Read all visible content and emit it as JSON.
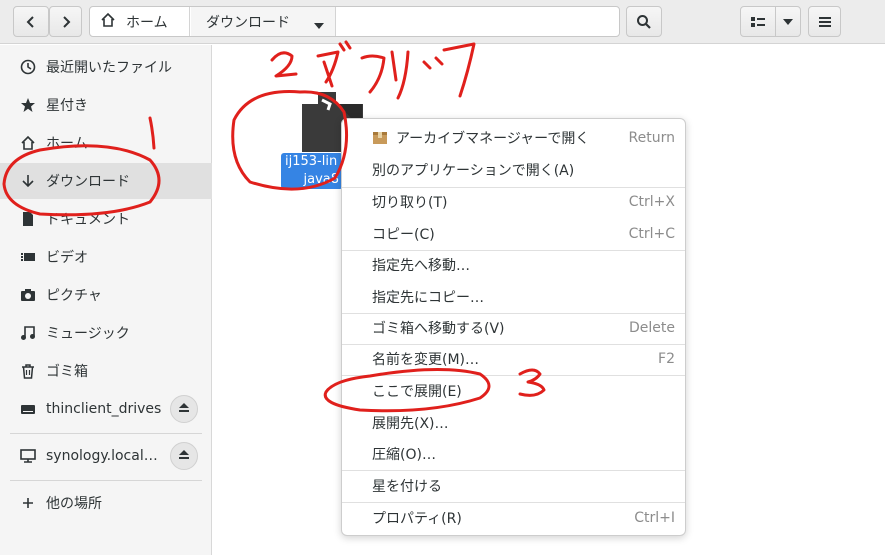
{
  "header": {
    "back_icon": "chevron-left-icon",
    "forward_icon": "chevron-right-icon",
    "crumb_home": "ホーム",
    "crumb_current": "ダウンロード",
    "search_icon": "search-icon",
    "view_icon": "grid-view-icon",
    "menu_icon": "hamburger-menu-icon"
  },
  "sidebar": {
    "items": [
      {
        "label": "最近開いたファイル",
        "icon": "clock-icon"
      },
      {
        "label": "星付き",
        "icon": "star-icon"
      },
      {
        "label": "ホーム",
        "icon": "home-icon"
      },
      {
        "label": "ダウンロード",
        "icon": "download-icon"
      },
      {
        "label": "ドキュメント",
        "icon": "document-icon"
      },
      {
        "label": "ビデオ",
        "icon": "video-icon"
      },
      {
        "label": "ピクチャ",
        "icon": "camera-icon"
      },
      {
        "label": "ミュージック",
        "icon": "music-icon"
      },
      {
        "label": "ゴミ箱",
        "icon": "trash-icon"
      },
      {
        "label": "thinclient_drives",
        "icon": "drive-icon"
      },
      {
        "label": "synology.local…",
        "icon": "network-icon"
      },
      {
        "label": "他の場所",
        "icon": "plus-icon"
      }
    ]
  },
  "file": {
    "name_line1": "ij153-lin",
    "name_line2": "java8"
  },
  "context_menu": {
    "items": [
      {
        "label": "アーカイブマネージャーで開く",
        "accel": "Return"
      },
      {
        "label": "別のアプリケーションで開く(A)",
        "accel": ""
      },
      {
        "label": "切り取り(T)",
        "accel": "Ctrl+X"
      },
      {
        "label": "コピー(C)",
        "accel": "Ctrl+C"
      },
      {
        "label": "指定先へ移動…",
        "accel": ""
      },
      {
        "label": "指定先にコピー…",
        "accel": ""
      },
      {
        "label": "ゴミ箱へ移動する(V)",
        "accel": "Delete"
      },
      {
        "label": "名前を変更(M)…",
        "accel": "F2"
      },
      {
        "label": "ここで展開(E)",
        "accel": ""
      },
      {
        "label": "展開先(X)…",
        "accel": ""
      },
      {
        "label": "圧縮(O)…",
        "accel": ""
      },
      {
        "label": "星を付ける",
        "accel": ""
      },
      {
        "label": "プロパティ(R)",
        "accel": "Ctrl+I"
      }
    ]
  },
  "colors": {
    "annotation": "#e0201c",
    "selection": "#3584e4"
  }
}
